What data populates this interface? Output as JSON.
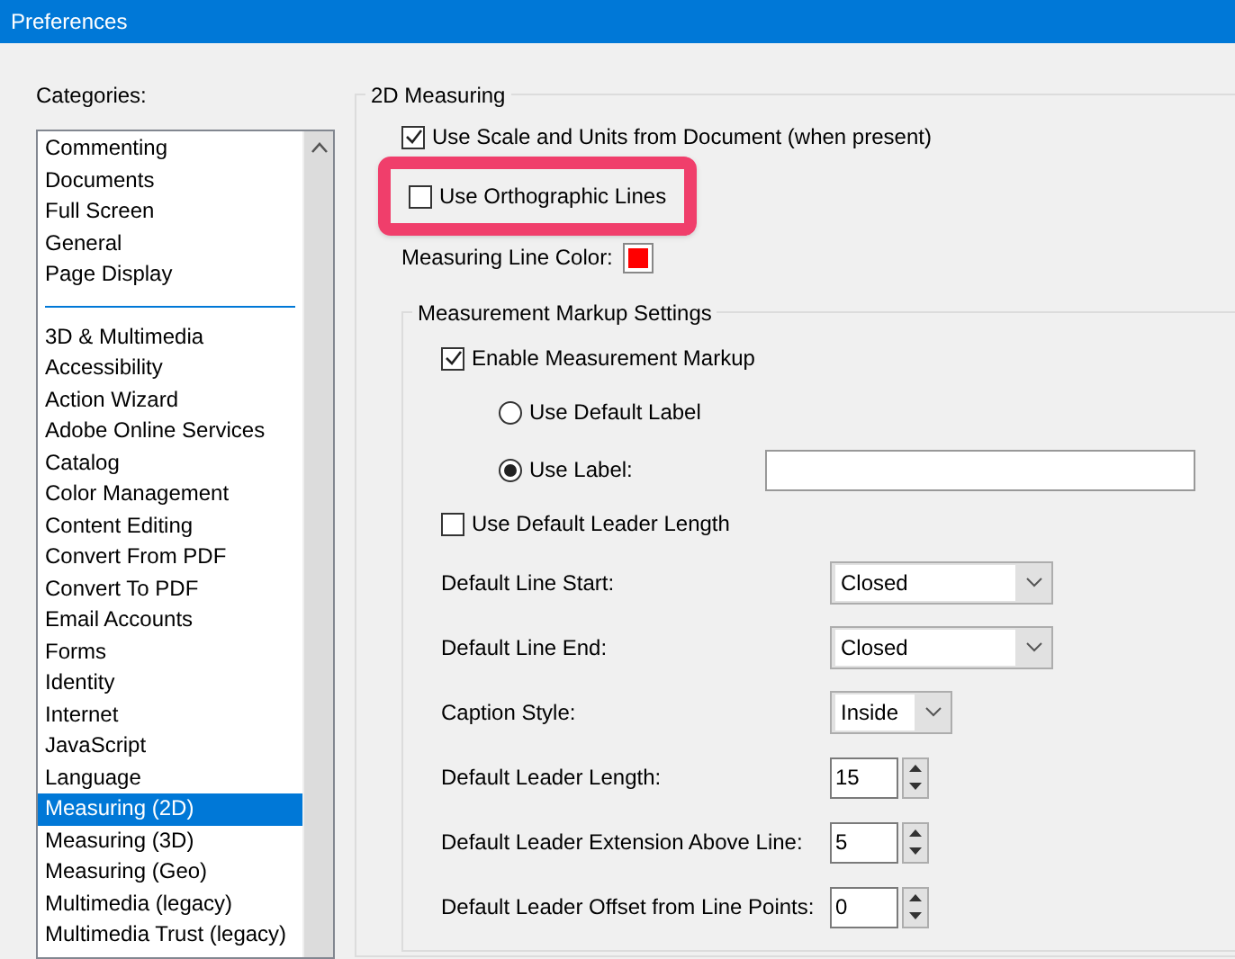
{
  "window": {
    "title": "Preferences"
  },
  "categories": {
    "label": "Categories:",
    "groups": [
      [
        {
          "label": "Commenting",
          "selected": false
        },
        {
          "label": "Documents",
          "selected": false
        },
        {
          "label": "Full Screen",
          "selected": false
        },
        {
          "label": "General",
          "selected": false
        },
        {
          "label": "Page Display",
          "selected": false
        }
      ],
      [
        {
          "label": "3D & Multimedia",
          "selected": false
        },
        {
          "label": "Accessibility",
          "selected": false
        },
        {
          "label": "Action Wizard",
          "selected": false
        },
        {
          "label": "Adobe Online Services",
          "selected": false
        },
        {
          "label": "Catalog",
          "selected": false
        },
        {
          "label": "Color Management",
          "selected": false
        },
        {
          "label": "Content Editing",
          "selected": false
        },
        {
          "label": "Convert From PDF",
          "selected": false
        },
        {
          "label": "Convert To PDF",
          "selected": false
        },
        {
          "label": "Email Accounts",
          "selected": false
        },
        {
          "label": "Forms",
          "selected": false
        },
        {
          "label": "Identity",
          "selected": false
        },
        {
          "label": "Internet",
          "selected": false
        },
        {
          "label": "JavaScript",
          "selected": false
        },
        {
          "label": "Language",
          "selected": false
        },
        {
          "label": "Measuring (2D)",
          "selected": true
        },
        {
          "label": "Measuring (3D)",
          "selected": false
        },
        {
          "label": "Measuring (Geo)",
          "selected": false
        },
        {
          "label": "Multimedia (legacy)",
          "selected": false
        },
        {
          "label": "Multimedia Trust (legacy)",
          "selected": false
        }
      ]
    ]
  },
  "measuring": {
    "title": "2D Measuring",
    "options": [
      {
        "label": "Use Scale and Units from Document (when present)",
        "checked": true,
        "highlighted": false
      },
      {
        "label": "Use Orthographic Lines",
        "checked": false,
        "highlighted": true
      }
    ],
    "line_color": {
      "label": "Measuring Line Color:",
      "color": "#ff0000"
    },
    "markup": {
      "title": "Measurement Markup Settings",
      "enable": {
        "label": "Enable Measurement Markup",
        "checked": true
      },
      "radios": [
        {
          "label": "Use Default Label",
          "selected": false,
          "kind": "plain"
        },
        {
          "label": "Use Label:",
          "selected": true,
          "kind": "text"
        }
      ],
      "leader": {
        "label": "Use Default Leader Length",
        "checked": false
      },
      "fields": [
        {
          "kind": "dropdown",
          "label": "Default Line Start:",
          "value": "Closed",
          "compact": false
        },
        {
          "kind": "dropdown",
          "label": "Default Line End:",
          "value": "Closed",
          "compact": false
        },
        {
          "kind": "dropdown",
          "label": "Caption Style:",
          "value": "Inside",
          "compact": true
        },
        {
          "kind": "spinner",
          "label": "Default Leader Length:",
          "value": "15"
        },
        {
          "kind": "spinner",
          "label": "Default Leader Extension Above Line:",
          "value": "5"
        },
        {
          "kind": "spinner",
          "label": "Default Leader Offset from Line Points:",
          "value": "0"
        }
      ]
    }
  }
}
